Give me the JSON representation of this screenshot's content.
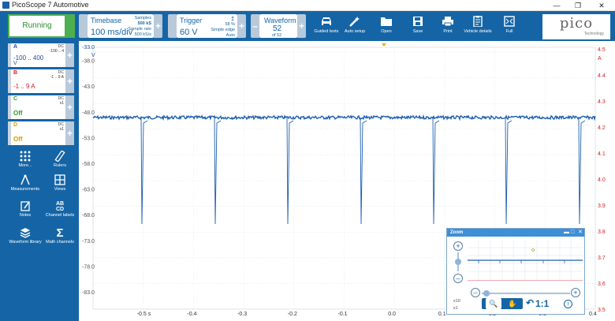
{
  "window": {
    "title": "PicoScope 7 Automotive",
    "controls": [
      "minimize-icon",
      "restore-icon",
      "close-icon"
    ]
  },
  "toolbar": {
    "run_label": "Running",
    "timebase": {
      "label": "Timebase",
      "value": "100 ms/div",
      "samples_label": "Samples",
      "samples_value": "500 kS",
      "rate_label": "Sample rate",
      "rate_value": "500 kS/s"
    },
    "trigger": {
      "label": "Trigger",
      "value": "60 V",
      "percent": "58 %",
      "mode": "Simple edge",
      "auto": "Auto"
    },
    "waveform": {
      "label": "Waveform",
      "value": "52",
      "of": "of 52"
    },
    "tools": [
      {
        "label": "Guided tests",
        "icon": "car-icon"
      },
      {
        "label": "Auto setup",
        "icon": "wand-icon"
      },
      {
        "label": "Open",
        "icon": "folder-icon"
      },
      {
        "label": "Save",
        "icon": "save-icon"
      },
      {
        "label": "Print",
        "icon": "print-icon"
      },
      {
        "label": "Vehicle details",
        "icon": "clipboard-icon"
      },
      {
        "label": "Full",
        "icon": "fullscreen-icon"
      }
    ],
    "logo": {
      "word": "pico",
      "sub": "Technology"
    }
  },
  "channels": [
    {
      "name": "A",
      "coupling": "DC",
      "range_hint": "-100 .. 4",
      "range": "-100 .. 400",
      "unit": "V",
      "color": "#1e4fa0"
    },
    {
      "name": "B",
      "coupling": "DC",
      "range_hint": "-1 .. 9 A",
      "range": "-1 .. 9 A",
      "unit": "",
      "color": "#d61f1f"
    },
    {
      "name": "C",
      "coupling": "DC",
      "probe": "x1",
      "range": "Off",
      "unit": "",
      "color": "#2e9b2e"
    },
    {
      "name": "D",
      "coupling": "DC",
      "probe": "x1",
      "range": "Off",
      "unit": "",
      "color": "#d4a000"
    }
  ],
  "side_tools": [
    {
      "label": "More...",
      "icon": "dots-grid-icon"
    },
    {
      "label": "Rulers",
      "icon": "ruler-icon"
    },
    {
      "label": "Measurements",
      "icon": "compass-icon"
    },
    {
      "label": "Views",
      "icon": "grid-icon"
    },
    {
      "label": "Notes",
      "icon": "note-icon"
    },
    {
      "label": "Channel labels",
      "icon": "abcd-icon"
    },
    {
      "label": "Waveform library",
      "icon": "stack-icon"
    },
    {
      "label": "Math channels",
      "icon": "sigma-icon"
    }
  ],
  "scope": {
    "left_axis_top": "-33.0",
    "left_axis_unit": "V",
    "left_ticks": [
      "-38.0",
      "-43.0",
      "-48.0",
      "-53.0",
      "-58.0",
      "-63.0",
      "-68.0",
      "-73.0",
      "-78.0",
      "-83.0"
    ],
    "right_ticks": [
      "4.5",
      "4.4",
      "4.3",
      "4.2",
      "4.1",
      "4.0",
      "3.9",
      "3.8",
      "3.7",
      "3.6",
      "3.5"
    ],
    "right_unit": "A",
    "x_ticks": [
      "-0.5 s",
      "-0.4",
      "-0.3",
      "-0.2",
      "-0.1",
      "0.0",
      "0.1",
      "0.2",
      "0.3",
      "0.4"
    ],
    "trace_color": "#1e5fb0",
    "right_axis_color": "#d61f1f"
  },
  "zoom": {
    "title": "Zoom",
    "scale_top": "x10",
    "scale_bottom": "x1",
    "one_to_one": "1:1"
  }
}
